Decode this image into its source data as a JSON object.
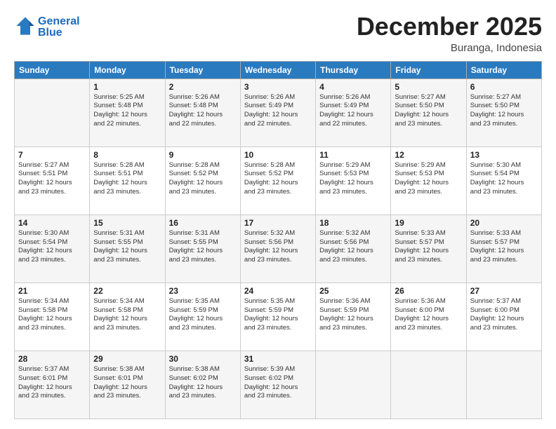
{
  "header": {
    "logo_line1": "General",
    "logo_line2": "Blue",
    "month": "December 2025",
    "location": "Buranga, Indonesia"
  },
  "weekdays": [
    "Sunday",
    "Monday",
    "Tuesday",
    "Wednesday",
    "Thursday",
    "Friday",
    "Saturday"
  ],
  "weeks": [
    [
      {
        "day": "",
        "info": ""
      },
      {
        "day": "1",
        "info": "Sunrise: 5:25 AM\nSunset: 5:48 PM\nDaylight: 12 hours\nand 22 minutes."
      },
      {
        "day": "2",
        "info": "Sunrise: 5:26 AM\nSunset: 5:48 PM\nDaylight: 12 hours\nand 22 minutes."
      },
      {
        "day": "3",
        "info": "Sunrise: 5:26 AM\nSunset: 5:49 PM\nDaylight: 12 hours\nand 22 minutes."
      },
      {
        "day": "4",
        "info": "Sunrise: 5:26 AM\nSunset: 5:49 PM\nDaylight: 12 hours\nand 22 minutes."
      },
      {
        "day": "5",
        "info": "Sunrise: 5:27 AM\nSunset: 5:50 PM\nDaylight: 12 hours\nand 23 minutes."
      },
      {
        "day": "6",
        "info": "Sunrise: 5:27 AM\nSunset: 5:50 PM\nDaylight: 12 hours\nand 23 minutes."
      }
    ],
    [
      {
        "day": "7",
        "info": "Sunrise: 5:27 AM\nSunset: 5:51 PM\nDaylight: 12 hours\nand 23 minutes."
      },
      {
        "day": "8",
        "info": "Sunrise: 5:28 AM\nSunset: 5:51 PM\nDaylight: 12 hours\nand 23 minutes."
      },
      {
        "day": "9",
        "info": "Sunrise: 5:28 AM\nSunset: 5:52 PM\nDaylight: 12 hours\nand 23 minutes."
      },
      {
        "day": "10",
        "info": "Sunrise: 5:28 AM\nSunset: 5:52 PM\nDaylight: 12 hours\nand 23 minutes."
      },
      {
        "day": "11",
        "info": "Sunrise: 5:29 AM\nSunset: 5:53 PM\nDaylight: 12 hours\nand 23 minutes."
      },
      {
        "day": "12",
        "info": "Sunrise: 5:29 AM\nSunset: 5:53 PM\nDaylight: 12 hours\nand 23 minutes."
      },
      {
        "day": "13",
        "info": "Sunrise: 5:30 AM\nSunset: 5:54 PM\nDaylight: 12 hours\nand 23 minutes."
      }
    ],
    [
      {
        "day": "14",
        "info": "Sunrise: 5:30 AM\nSunset: 5:54 PM\nDaylight: 12 hours\nand 23 minutes."
      },
      {
        "day": "15",
        "info": "Sunrise: 5:31 AM\nSunset: 5:55 PM\nDaylight: 12 hours\nand 23 minutes."
      },
      {
        "day": "16",
        "info": "Sunrise: 5:31 AM\nSunset: 5:55 PM\nDaylight: 12 hours\nand 23 minutes."
      },
      {
        "day": "17",
        "info": "Sunrise: 5:32 AM\nSunset: 5:56 PM\nDaylight: 12 hours\nand 23 minutes."
      },
      {
        "day": "18",
        "info": "Sunrise: 5:32 AM\nSunset: 5:56 PM\nDaylight: 12 hours\nand 23 minutes."
      },
      {
        "day": "19",
        "info": "Sunrise: 5:33 AM\nSunset: 5:57 PM\nDaylight: 12 hours\nand 23 minutes."
      },
      {
        "day": "20",
        "info": "Sunrise: 5:33 AM\nSunset: 5:57 PM\nDaylight: 12 hours\nand 23 minutes."
      }
    ],
    [
      {
        "day": "21",
        "info": "Sunrise: 5:34 AM\nSunset: 5:58 PM\nDaylight: 12 hours\nand 23 minutes."
      },
      {
        "day": "22",
        "info": "Sunrise: 5:34 AM\nSunset: 5:58 PM\nDaylight: 12 hours\nand 23 minutes."
      },
      {
        "day": "23",
        "info": "Sunrise: 5:35 AM\nSunset: 5:59 PM\nDaylight: 12 hours\nand 23 minutes."
      },
      {
        "day": "24",
        "info": "Sunrise: 5:35 AM\nSunset: 5:59 PM\nDaylight: 12 hours\nand 23 minutes."
      },
      {
        "day": "25",
        "info": "Sunrise: 5:36 AM\nSunset: 5:59 PM\nDaylight: 12 hours\nand 23 minutes."
      },
      {
        "day": "26",
        "info": "Sunrise: 5:36 AM\nSunset: 6:00 PM\nDaylight: 12 hours\nand 23 minutes."
      },
      {
        "day": "27",
        "info": "Sunrise: 5:37 AM\nSunset: 6:00 PM\nDaylight: 12 hours\nand 23 minutes."
      }
    ],
    [
      {
        "day": "28",
        "info": "Sunrise: 5:37 AM\nSunset: 6:01 PM\nDaylight: 12 hours\nand 23 minutes."
      },
      {
        "day": "29",
        "info": "Sunrise: 5:38 AM\nSunset: 6:01 PM\nDaylight: 12 hours\nand 23 minutes."
      },
      {
        "day": "30",
        "info": "Sunrise: 5:38 AM\nSunset: 6:02 PM\nDaylight: 12 hours\nand 23 minutes."
      },
      {
        "day": "31",
        "info": "Sunrise: 5:39 AM\nSunset: 6:02 PM\nDaylight: 12 hours\nand 23 minutes."
      },
      {
        "day": "",
        "info": ""
      },
      {
        "day": "",
        "info": ""
      },
      {
        "day": "",
        "info": ""
      }
    ]
  ]
}
